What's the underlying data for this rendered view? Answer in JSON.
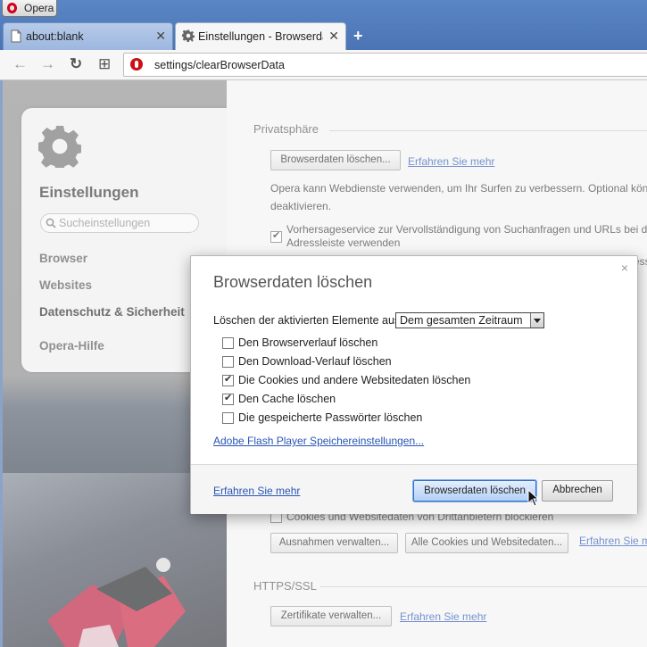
{
  "window": {
    "menu_button_label": "Opera",
    "tabs": [
      {
        "label": "about:blank",
        "active": false,
        "icon": "page-icon"
      },
      {
        "label": "Einstellungen - Browserdat",
        "active": true,
        "icon": "gear-icon"
      }
    ],
    "new_tab_symbol": "+",
    "close_symbol": "✕"
  },
  "toolbar": {
    "back_symbol": "←",
    "forward_symbol": "→",
    "reload_symbol": "↻",
    "speed_dial_symbol": "⊞",
    "address": "settings/clearBrowserData"
  },
  "sidebar": {
    "title": "Einstellungen",
    "search_placeholder": "Sucheinstellungen",
    "items": [
      {
        "label": "Browser"
      },
      {
        "label": "Websites"
      },
      {
        "label": "Datenschutz & Sicherheit"
      },
      {
        "label": "Opera-Hilfe"
      }
    ]
  },
  "content": {
    "privacy_heading": "Privatsphäre",
    "clear_button": "Browserdaten löschen...",
    "learn_more_1": "Erfahren Sie mehr",
    "privacy_text_1": "Opera kann Webdienste verwenden, um Ihr Surfen zu verbessern. Optional könne",
    "privacy_text_2": "deaktivieren.",
    "prediction_text_1": "Vorhersageservice zur Vervollständigung von Suchanfragen und URLs bei der",
    "prediction_text_2": "Adressleiste verwenden",
    "prediction_checked": true,
    "partial_text": "ess",
    "third_party_label": "Cookies und Websitedaten von Drittanbietern blockieren",
    "third_party_checked": false,
    "exceptions_button": "Ausnahmen verwalten...",
    "all_cookies_button": "Alle Cookies und Websitedaten...",
    "learn_more_2": "Erfahren Sie m",
    "https_heading": "HTTPS/SSL",
    "certificates_button": "Zertifikate verwalten...",
    "learn_more_3": "Erfahren Sie mehr"
  },
  "dialog": {
    "title": "Browserdaten löschen",
    "close_symbol": "×",
    "range_label": "Löschen der aktivierten Elemente aus:",
    "range_value": "Dem gesamten Zeitraum",
    "options": [
      {
        "label": "Den Browserverlauf löschen",
        "checked": false
      },
      {
        "label": "Den Download-Verlauf löschen",
        "checked": false
      },
      {
        "label": "Die Cookies und andere Websitedaten löschen",
        "checked": true
      },
      {
        "label": "Den Cache löschen",
        "checked": true
      },
      {
        "label": "Die gespeicherte Passwörter löschen",
        "checked": false
      }
    ],
    "flash_link": "Adobe Flash Player Speichereinstellungen...",
    "learn_more": "Erfahren Sie mehr",
    "confirm_button": "Browserdaten löschen",
    "cancel_button": "Abbrechen"
  },
  "colors": {
    "window_frame": "#4a74b3",
    "opera_red": "#cc0f16",
    "link": "#2a56b5",
    "primary_button": "#b4d0f5"
  }
}
